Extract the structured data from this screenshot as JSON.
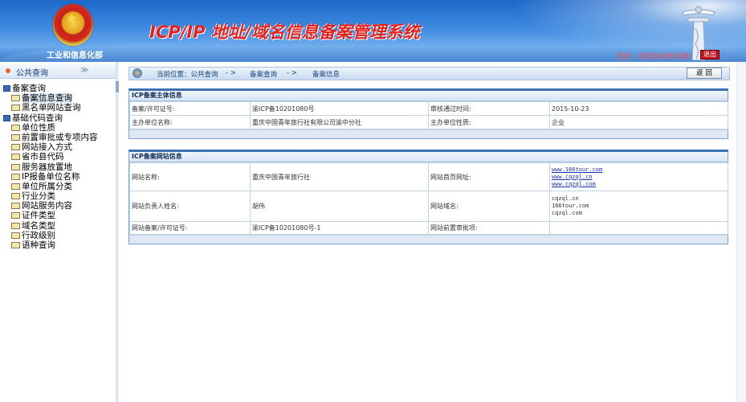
{
  "header": {
    "ministry": "工业和信息化部",
    "system_title": "ICP/IP 地址/域名信息备案管理系统",
    "welcome": "您好，欢迎访问本系统!",
    "logout": "退出"
  },
  "sidebar": {
    "title": "公共查询",
    "chevron": "≫",
    "tree": [
      {
        "label": "备案查询",
        "level": 1,
        "type": "folder"
      },
      {
        "label": "备案信息查询",
        "level": 2,
        "type": "item",
        "selected": true
      },
      {
        "label": "黑名单网站查询",
        "level": 2,
        "type": "item"
      },
      {
        "label": "基础代码查询",
        "level": 1,
        "type": "folder"
      },
      {
        "label": "单位性质",
        "level": 2,
        "type": "item"
      },
      {
        "label": "前置审批或专项内容",
        "level": 2,
        "type": "item"
      },
      {
        "label": "网站接入方式",
        "level": 2,
        "type": "item"
      },
      {
        "label": "省市县代码",
        "level": 2,
        "type": "item"
      },
      {
        "label": "服务器放置地",
        "level": 2,
        "type": "item"
      },
      {
        "label": "IP报备单位名称",
        "level": 2,
        "type": "item"
      },
      {
        "label": "单位所属分类",
        "level": 2,
        "type": "item"
      },
      {
        "label": "行业分类",
        "level": 2,
        "type": "item"
      },
      {
        "label": "网站服务内容",
        "level": 2,
        "type": "item"
      },
      {
        "label": "证件类型",
        "level": 2,
        "type": "item"
      },
      {
        "label": "域名类型",
        "level": 2,
        "type": "item"
      },
      {
        "label": "行政级别",
        "level": 2,
        "type": "item"
      },
      {
        "label": "语种查询",
        "level": 2,
        "type": "item"
      }
    ]
  },
  "breadcrumb": {
    "prefix": "当前位置：公共查询",
    "sep1": "- >",
    "mid": "备案查询",
    "sep2": "- >",
    "last": "备案信息",
    "back": "返 回"
  },
  "subject_panel": {
    "title": "ICP备案主体信息",
    "rows": [
      {
        "l1": "备案/许可证号:",
        "v1": "渝ICP备10201080号",
        "l2": "审核通过时间:",
        "v2": "2015-10-23"
      },
      {
        "l1": "主办单位名称:",
        "v1": "重庆中国青年旅行社有限公司渝中分社",
        "l2": "主办单位性质:",
        "v2": "企业"
      }
    ]
  },
  "site_panel": {
    "title": "ICP备案网站信息",
    "site_name_label": "网站名称:",
    "site_name": "重庆中国青年旅行社",
    "homepage_label": "网站首页网址:",
    "homepages": [
      "www.166tour.com",
      "www.cqzql.cn",
      "www.cqzql.com"
    ],
    "owner_label": "网站负责人姓名:",
    "owner": "胡伟",
    "domain_label": "网站域名:",
    "domains": [
      "cqzql.cn",
      "166tour.com",
      "cqzql.com"
    ],
    "site_license_label": "网站备案/许可证号:",
    "site_license": "渝ICP备10201080号-1",
    "preapproval_label": "网站前置审批项:",
    "preapproval": ""
  }
}
